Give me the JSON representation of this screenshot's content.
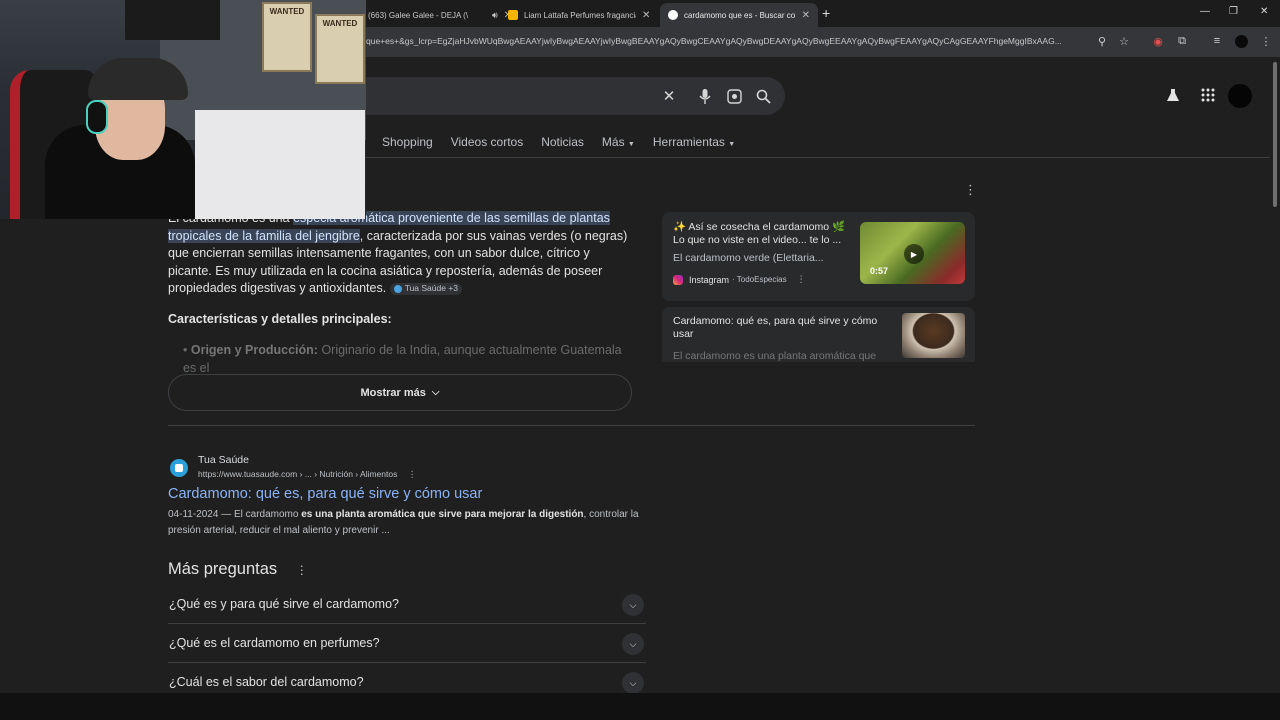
{
  "browser": {
    "tabs": [
      {
        "title": "(663) Galee Galee - DEJA (\\",
        "active": false
      },
      {
        "title": "Liam Lattafa Perfumes fragancia",
        "active": false
      },
      {
        "title": "cardamomo que es - Buscar co",
        "active": true
      }
    ],
    "url": "que+es+&gs_lcrp=EgZjaHJvbWUqBwgAEAAYjwIyBwgAEAAYjwIyBwgBEAAYgAQyBwgCEAAYgAQyBwgDEAAYgAQyBwgEEAAYgAQyBwgFEAAYgAQyCAgGEAAYFhgeMggIBxAAG..."
  },
  "search": {
    "tabs": [
      "Shopping",
      "Videos cortos",
      "Noticias",
      "Más",
      "Herramientas"
    ]
  },
  "overview": {
    "p_start": "El cardamomo es una ",
    "p_hl": "especia aromática proveniente de las semillas de plantas tropicales de la familia del jengibre",
    "p_end": ", caracterizada por sus vainas verdes (o negras) que encierran semillas intensamente fragantes, con un sabor dulce, cítrico y picante. Es muy utilizada en la cocina asiática y repostería, además de poseer propiedades digestivas y antioxidantes.",
    "source_chip": "Tua Saúde +3",
    "subheading": "Características y detalles principales:",
    "faded_label": "Origen y Producción:",
    "faded_text": " Originario de la India, aunque actualmente Guatemala es el",
    "show_more": "Mostrar más"
  },
  "side_cards": [
    {
      "title": "✨ Así se cosecha el cardamomo 🌿 Lo que no viste en el video... te lo ...",
      "subtitle": "El cardamomo verde (Elettaria...",
      "source": "Instagram",
      "source_detail": "· TodoEspecias",
      "duration": "0:57"
    },
    {
      "title": "Cardamomo: qué es, para qué sirve y cómo usar",
      "subtitle": "El cardamomo es una planta aromática que"
    }
  ],
  "result": {
    "site": "Tua Saúde",
    "url": "https://www.tuasaude.com › ... › Nutrición › Alimentos",
    "title": "Cardamomo: qué es, para qué sirve y cómo usar",
    "date": "04-11-2024 — El cardamomo ",
    "snippet_bold": "es una planta aromática que sirve para mejorar la digestión",
    "snippet_end": ", controlar la presión arterial, reducir el mal aliento y prevenir ..."
  },
  "paa": {
    "heading": "Más preguntas",
    "questions": [
      "¿Qué es y para qué sirve el cardamomo?",
      "¿Qué es el cardamomo en perfumes?",
      "¿Cuál es el sabor del cardamomo?"
    ]
  },
  "webcam": {
    "poster1": "WANTED",
    "poster2": "WANTED"
  },
  "colors": {
    "background": "#1f1f1f",
    "link": "#8ab4f8",
    "highlight": "#394457"
  }
}
